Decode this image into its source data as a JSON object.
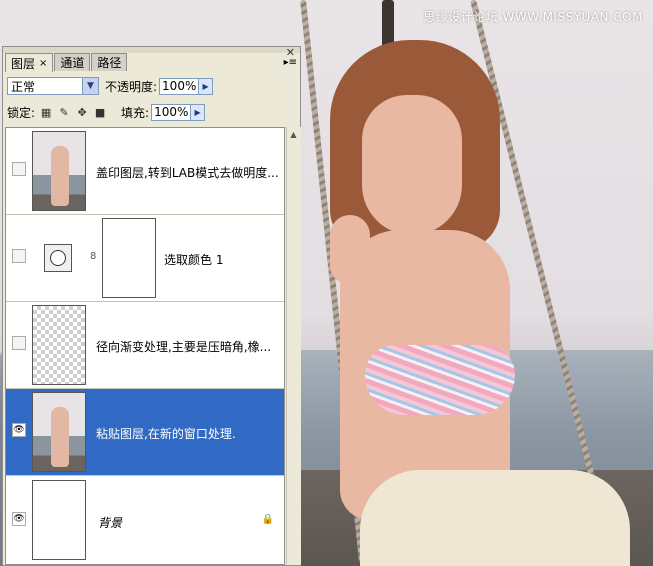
{
  "watermark": "思缘设计论坛 WWW.MISSYUAN.COM",
  "panel": {
    "tabs": [
      {
        "label": "图层",
        "active": true,
        "closable": true
      },
      {
        "label": "通道",
        "active": false
      },
      {
        "label": "路径",
        "active": false
      }
    ],
    "blend_mode": "正常",
    "opacity_label": "不透明度:",
    "opacity_value": "100%",
    "lock_label": "锁定:",
    "lock_icons": [
      "lock-transparent-icon",
      "lock-brush-icon",
      "lock-move-icon",
      "lock-all-icon"
    ],
    "fill_label": "填充:",
    "fill_value": "100%",
    "selection_color": "#316ac5"
  },
  "layers": [
    {
      "name": "盖印图层,转到LAB模式去做明度...",
      "visible": false,
      "thumb": "photo",
      "selected": false
    },
    {
      "name": "选取颜色 1",
      "visible": false,
      "thumb": "adjustment",
      "selected": false
    },
    {
      "name": "径向渐变处理,主要是压暗角,橡...",
      "visible": false,
      "thumb": "transparent",
      "selected": false
    },
    {
      "name": "粘贴图层,在新的窗口处理.",
      "visible": true,
      "thumb": "photo",
      "selected": true
    },
    {
      "name": "背景",
      "visible": true,
      "thumb": "white",
      "selected": false,
      "locked": true
    }
  ]
}
